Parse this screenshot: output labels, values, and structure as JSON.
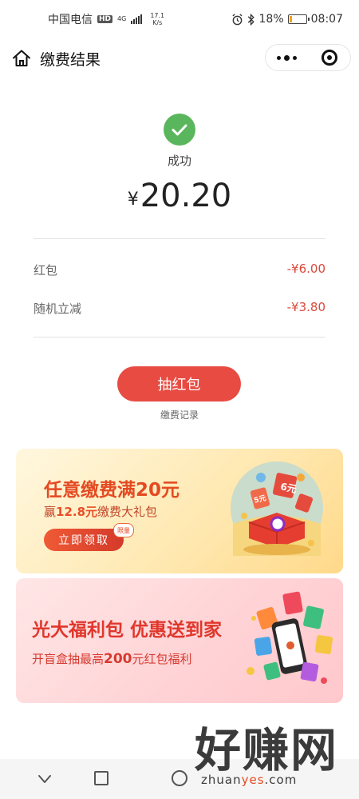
{
  "status_bar": {
    "carrier": "中国电信",
    "hd": "HD",
    "network": "4G",
    "speed_value": "17.1",
    "speed_unit": "K/s",
    "battery": "18%",
    "battery_level": 0.18,
    "time": "08:07"
  },
  "header": {
    "title": "缴费结果"
  },
  "result": {
    "status": "成功",
    "currency": "¥",
    "amount": "20.20",
    "rows": [
      {
        "label": "红包",
        "value": "-¥6.00"
      },
      {
        "label": "随机立减",
        "value": "-¥3.80"
      }
    ],
    "draw_button": "抽红包",
    "record_link": "缴费记录"
  },
  "banners": [
    {
      "title": "任意缴费满20元",
      "sub_prefix": "赢",
      "sub_highlight": "12.8元",
      "sub_suffix": "缴费大礼包",
      "button": "立即领取",
      "badge": "限量",
      "art_label": "6元",
      "art_label_small": "5元"
    },
    {
      "title": "光大福利包 优惠送到家",
      "sub_prefix": "开盲盒抽最高",
      "sub_highlight": "200",
      "sub_suffix": "元红包福利"
    }
  ],
  "watermark": {
    "text": "好赚网",
    "url_prefix": "zhuan",
    "url_highlight": "yes",
    "url_suffix": ".com"
  },
  "colors": {
    "accent": "#e74b42",
    "success": "#5ab65c",
    "discount": "#d9483b"
  }
}
